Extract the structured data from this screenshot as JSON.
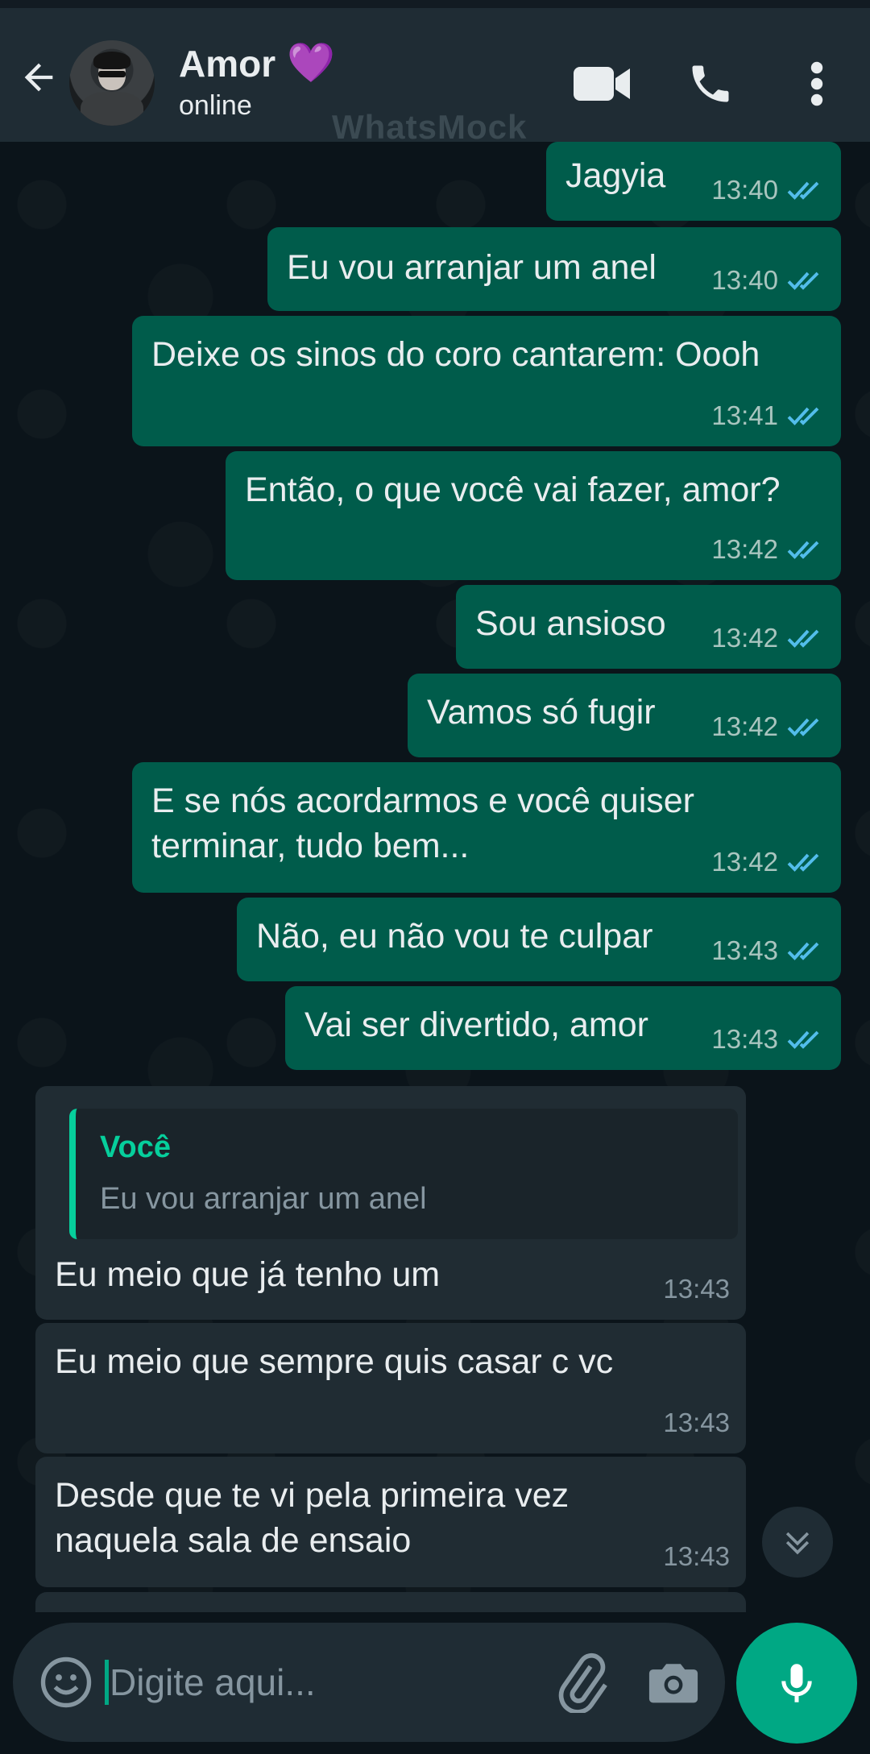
{
  "header": {
    "contact_name": "Amor",
    "contact_emoji": "💜",
    "contact_status": "online",
    "watermark": "WhatsMock",
    "icons": [
      "back-arrow-icon",
      "video-call-icon",
      "phone-call-icon",
      "more-options-icon"
    ]
  },
  "messages": [
    {
      "direction": "out",
      "text": "Jagyia",
      "time": "13:40",
      "status": "read"
    },
    {
      "direction": "out",
      "text": "Eu vou arranjar um anel",
      "time": "13:40",
      "status": "read"
    },
    {
      "direction": "out",
      "text": "Deixe os sinos do coro cantarem: Oooh",
      "time": "13:41",
      "status": "read"
    },
    {
      "direction": "out",
      "text": "Então, o que você vai fazer, amor?",
      "time": "13:42",
      "status": "read"
    },
    {
      "direction": "out",
      "text": "Sou ansioso",
      "time": "13:42",
      "status": "read"
    },
    {
      "direction": "out",
      "text": "Vamos só fugir",
      "time": "13:42",
      "status": "read"
    },
    {
      "direction": "out",
      "text_line1": "E se nós acordarmos e você quiser",
      "text_line2": "terminar, tudo bem...",
      "time": "13:42",
      "status": "read"
    },
    {
      "direction": "out",
      "text": "Não, eu não vou te culpar",
      "time": "13:43",
      "status": "read"
    },
    {
      "direction": "out",
      "text": "Vai ser divertido, amor",
      "time": "13:43",
      "status": "read"
    },
    {
      "direction": "in",
      "quote_author": "Você",
      "quote_text": "Eu vou arranjar um anel",
      "text": "Eu meio que já tenho um",
      "time": "13:43"
    },
    {
      "direction": "in",
      "text": "Eu meio que sempre quis casar c vc",
      "time": "13:43"
    },
    {
      "direction": "in",
      "text_line1": "Desde que te vi pela primeira vez",
      "text_line2": "naquela sala de ensaio",
      "time": "13:43"
    }
  ],
  "composer": {
    "placeholder": "Digite aqui...",
    "icons": [
      "emoji-icon",
      "attach-icon",
      "camera-icon",
      "mic-icon"
    ]
  },
  "colors": {
    "header_bg": "#1f2c34",
    "chat_bg": "#0b141a",
    "outgoing_bubble": "#005c4b",
    "incoming_bubble": "#202c33",
    "accent": "#00a884",
    "read_ticks": "#53bdeb"
  }
}
